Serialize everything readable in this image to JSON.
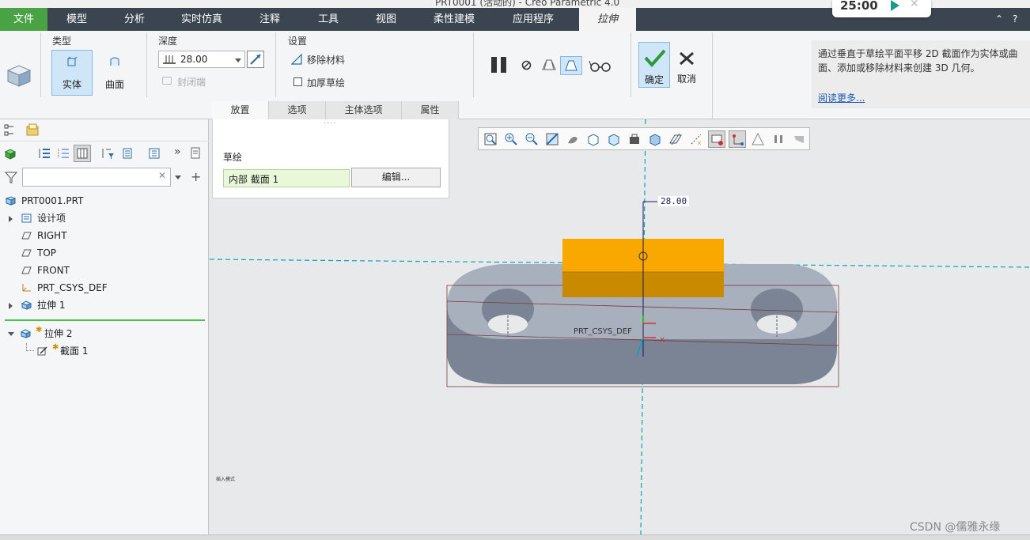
{
  "window": {
    "title_fragment": "PRT0001 (活动的) - Creo Parametric 4.0"
  },
  "timer": {
    "time": "25:00"
  },
  "menu": {
    "file": "文件",
    "items": [
      "模型",
      "分析",
      "实时仿真",
      "注释",
      "工具",
      "视图",
      "柔性建模",
      "应用程序"
    ],
    "active_tab": "拉伸"
  },
  "ribbon": {
    "type": {
      "label": "类型",
      "solid": "实体",
      "surface": "曲面"
    },
    "depth": {
      "label": "深度",
      "value": "28.00",
      "capped_ends": "封闭端"
    },
    "settings": {
      "label": "设置",
      "remove_material": "移除材料",
      "thicken_sketch": "加厚草绘"
    },
    "ok": "确定",
    "cancel": "取消",
    "subtabs": [
      "放置",
      "选项",
      "主体选项",
      "属性"
    ],
    "help_text": "通过垂直于草绘平面平移 2D 截面作为实体或曲面、添加或移除材料来创建 3D 几何。",
    "help_link": "阅读更多..."
  },
  "placement": {
    "sketch_label": "草绘",
    "sketch_value": "内部 截面 1",
    "edit_button": "编辑..."
  },
  "model_tree": {
    "root": "PRT0001.PRT",
    "items": [
      {
        "label": "设计项",
        "icon": "design-items-icon",
        "expandable": true
      },
      {
        "label": "RIGHT",
        "icon": "datum-plane-icon"
      },
      {
        "label": "TOP",
        "icon": "datum-plane-icon"
      },
      {
        "label": "FRONT",
        "icon": "datum-plane-icon"
      },
      {
        "label": "PRT_CSYS_DEF",
        "icon": "csys-icon"
      },
      {
        "label": "拉伸 1",
        "icon": "extrude-icon",
        "expandable": true
      }
    ],
    "active_feature": "拉伸 2",
    "active_child": "截面 1"
  },
  "graphics": {
    "dimension": "28.00",
    "csys_label": "PRT_CSYS_DEF",
    "axis_x": "X",
    "tiny_text": "插入模式"
  },
  "watermark": "CSDN @儒雅永缘",
  "colors": {
    "menubar": "#3a4550",
    "file_tab": "#49a345",
    "extrude_preview": "#f9a800",
    "part_body": "#a8b0be",
    "axis_cyan": "#00a8b8"
  }
}
